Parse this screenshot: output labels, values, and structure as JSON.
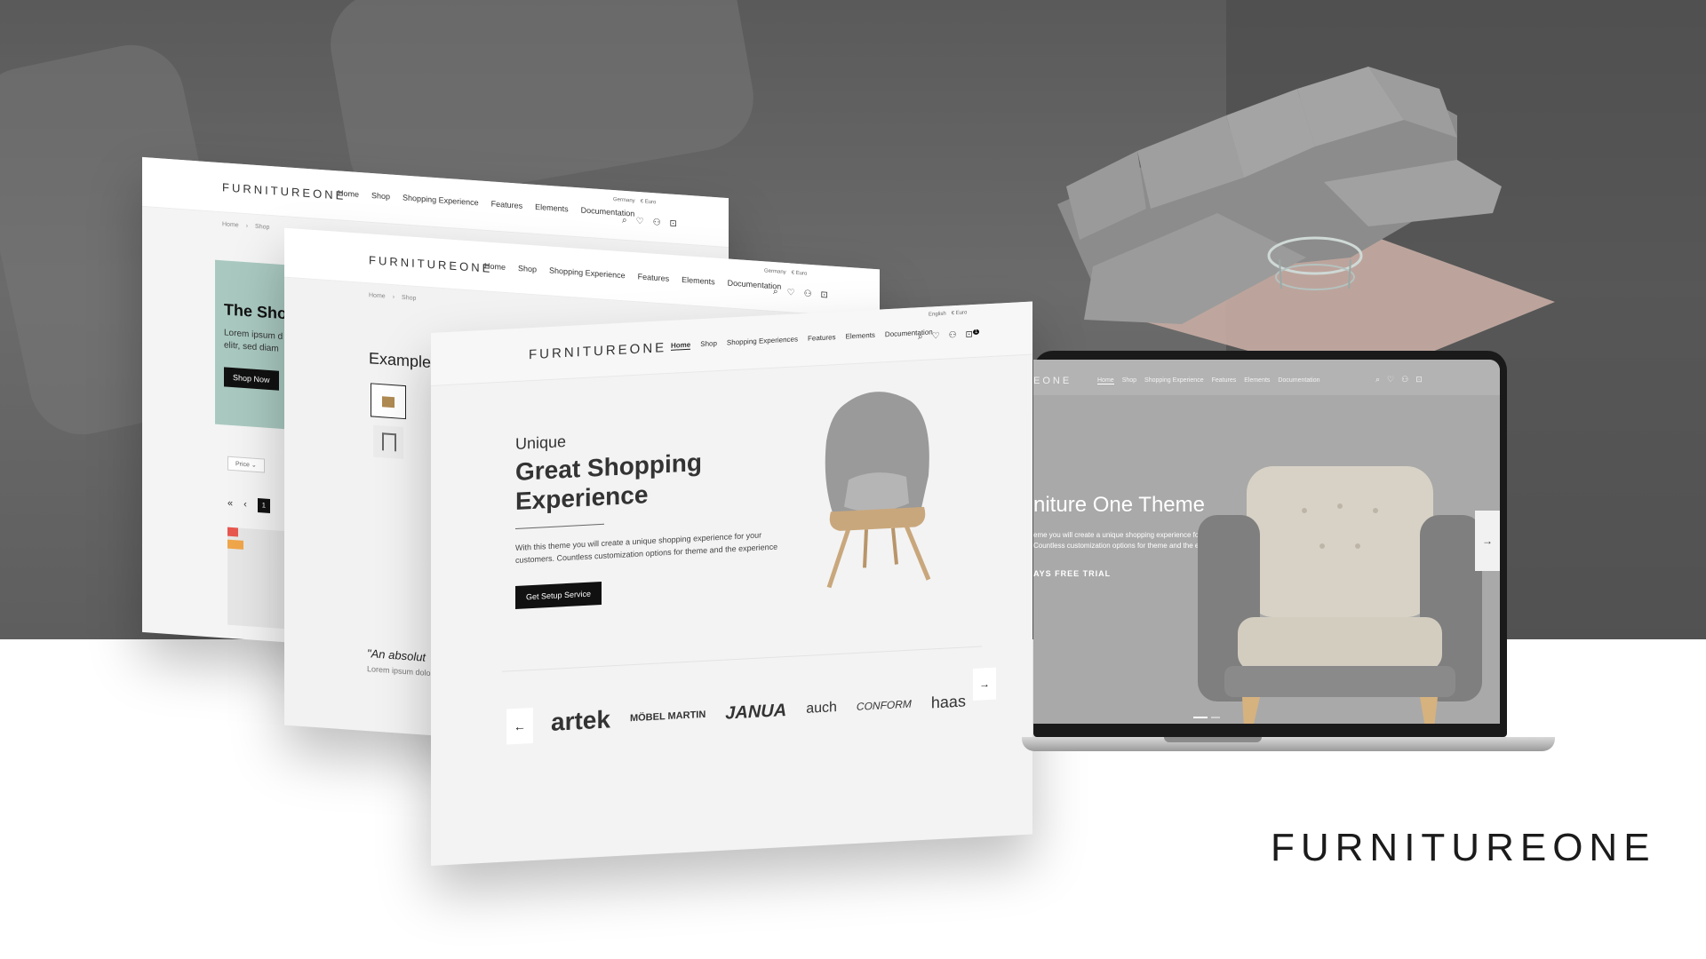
{
  "brand": {
    "logo": "FURNITUREONE"
  },
  "nav": {
    "links": [
      "Home",
      "Shop",
      "Shopping Experience",
      "Features",
      "Elements",
      "Documentation"
    ],
    "links_front": [
      "Home",
      "Shop",
      "Shopping Experiences",
      "Features",
      "Elements",
      "Documentation"
    ],
    "locale_country": "Germany",
    "locale_currency": "€ Euro",
    "locale_language": "English",
    "cart_count": "1"
  },
  "screen1": {
    "breadcrumb": [
      "Home",
      "Shop"
    ],
    "hero_title": "The Shop",
    "hero_text": "Lorem ipsum d elitr, sed diam",
    "hero_button": "Shop Now",
    "filter_label": "Price",
    "pager": [
      "«",
      "‹",
      "1"
    ]
  },
  "screen2": {
    "breadcrumb": [
      "Home",
      "Shop"
    ],
    "example_title": "Example",
    "quote": "\"An absolut",
    "quote_sub": "Lorem ipsum dolo"
  },
  "screen3": {
    "kicker": "Unique",
    "title": "Great Shopping Experience",
    "description": "With this theme you will create a unique shopping experience for your customers. Countless customization options for theme and the experience",
    "cta": "Get Setup Service",
    "brands": [
      "artek",
      "MÖBEL MARTIN",
      "JANUA",
      "auch",
      "CONFORM",
      "haas"
    ],
    "arrow_prev": "←",
    "arrow_next": "→"
  },
  "laptop": {
    "logo_partial": "EONE",
    "hero_title": "niture One Theme",
    "hero_desc": "eme you will create a unique shopping experience for your Countless customization options for theme and the experience",
    "hero_cta": "AYS FREE TRIAL",
    "next_arrow": "→"
  },
  "footer_brand": "FURNITUREONE"
}
